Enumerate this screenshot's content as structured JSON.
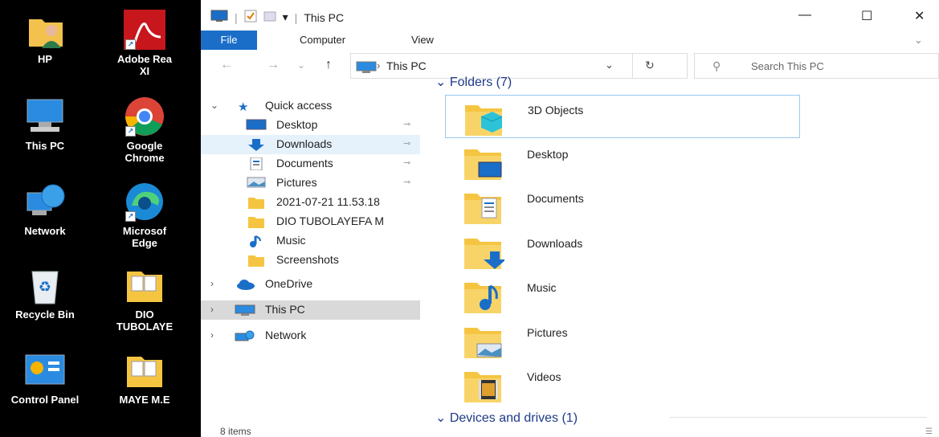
{
  "desktop": {
    "icons": [
      {
        "name": "HP",
        "type": "user"
      },
      {
        "name": "Adobe Rea\nXI",
        "type": "pdf"
      },
      {
        "name": "This PC",
        "type": "pc"
      },
      {
        "name": "Google\nChrome",
        "type": "chrome"
      },
      {
        "name": "Network",
        "type": "network"
      },
      {
        "name": "Microsof\nEdge",
        "type": "edge"
      },
      {
        "name": "Recycle Bin",
        "type": "recycle"
      },
      {
        "name": "DIO\nTUBOLAYE",
        "type": "folder"
      },
      {
        "name": "Control Panel",
        "type": "control"
      },
      {
        "name": "MAYE M.E",
        "type": "folder"
      }
    ]
  },
  "window": {
    "title": "This PC",
    "controls": {
      "minimize": "—",
      "maximize": "☐",
      "close": "✕"
    }
  },
  "ribbon": {
    "tabs": [
      "File",
      "Computer",
      "View"
    ],
    "expand": "⌄"
  },
  "address": {
    "back": "←",
    "forward": "→",
    "recent": "⌄",
    "up": "↑",
    "separator": "›",
    "path": "This PC",
    "dropdown": "⌄",
    "refresh": "↻"
  },
  "search": {
    "icon": "⚲",
    "placeholder": "Search This PC"
  },
  "nav": {
    "quick_access": "Quick access",
    "items": [
      {
        "label": "Desktop",
        "icon": "desktop-icon",
        "pinned": true
      },
      {
        "label": "Downloads",
        "icon": "downloads-icon",
        "pinned": true
      },
      {
        "label": "Documents",
        "icon": "documents-icon",
        "pinned": true
      },
      {
        "label": "Pictures",
        "icon": "pictures-icon",
        "pinned": true
      },
      {
        "label": "2021-07-21 11.53.18",
        "icon": "folder-icon",
        "pinned": false
      },
      {
        "label": "DIO TUBOLAYEFA M",
        "icon": "folder-icon",
        "pinned": false
      },
      {
        "label": "Music",
        "icon": "music-icon",
        "pinned": false
      },
      {
        "label": "Screenshots",
        "icon": "folder-icon",
        "pinned": false
      }
    ],
    "onedrive": "OneDrive",
    "this_pc": "This PC",
    "network": "Network"
  },
  "content": {
    "folders_header": "⌄ Folders (7)",
    "folders": [
      "3D Objects",
      "Desktop",
      "Documents",
      "Downloads",
      "Music",
      "Pictures",
      "Videos"
    ],
    "devices_header": "⌄ Devices and drives (1)"
  },
  "status": {
    "items": "8 items"
  },
  "colors": {
    "accent": "#1a6ec8",
    "selection": "#e5f1fb",
    "folder": "#f5c542"
  }
}
